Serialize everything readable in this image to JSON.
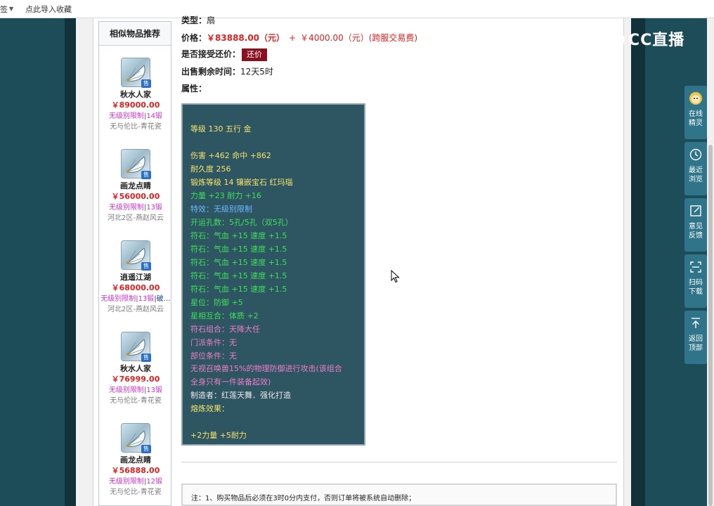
{
  "bookmarks_bar": {
    "dropdown_label": "签",
    "import_link": "点此导入收藏"
  },
  "sidebar": {
    "title": "相似物品推荐",
    "sale_badge": "售",
    "items": [
      {
        "name": "秋水人家",
        "price": "￥89000.00",
        "tag1": "无级别限制",
        "sep": "|",
        "tag2": "14锻",
        "tag3": "",
        "server": "无与伦比-青花瓷",
        "icon": "fan-icon"
      },
      {
        "name": "画龙点睛",
        "price": "￥56000.00",
        "tag1": "无级别限制",
        "sep": "|",
        "tag2": "13锻",
        "tag3": "",
        "server": "河北2区-燕赵风云",
        "icon": "fan-icon"
      },
      {
        "name": "逍遥江湖",
        "price": "￥68000.00",
        "tag1": "无级别限制",
        "sep": "|",
        "tag2": "13锻",
        "tag3": "|破…",
        "server": "河北2区-燕赵风云",
        "icon": "fan-icon"
      },
      {
        "name": "秋水人家",
        "price": "￥76999.00",
        "tag1": "无级别限制",
        "sep": "|",
        "tag2": "13锻",
        "tag3": "",
        "server": "无与伦比-青花瓷",
        "icon": "fan-icon"
      },
      {
        "name": "画龙点睛",
        "price": "￥56888.00",
        "tag1": "无级别限制",
        "sep": "|",
        "tag2": "12锻",
        "tag3": "",
        "server": "无与伦比-青花瓷",
        "icon": "fan-icon"
      }
    ]
  },
  "detail": {
    "type_label": "类型：",
    "type_value": "扇",
    "price_label": "价格：",
    "price_value": "￥83888.00（元）",
    "price_plus": "+",
    "fee_value": "￥4000.00（元）(跨服交易费)",
    "bargain_label": "是否接受还价：",
    "bargain_button": "还价",
    "time_label": "出售剩余时间：",
    "time_value": "12天5时",
    "attr_label": "属性："
  },
  "attributes": [
    {
      "text": "等级 130 五行 金",
      "color": "yellow"
    },
    {
      "text": "伤害 +462 命中 +862",
      "color": "yellow"
    },
    {
      "text": "耐久度 256",
      "color": "yellow"
    },
    {
      "text": "锻炼等级 14 镶嵌宝石 红玛瑙",
      "color": "yellow"
    },
    {
      "text": "力量 +23 耐力 +16",
      "color": "green"
    },
    {
      "text": "特效：无级别限制",
      "color": "blue"
    },
    {
      "text": "开运孔数：5孔/5孔（双5孔）",
      "color": "green"
    },
    {
      "text": "符石：气血 +15 速度 +1.5",
      "color": "green"
    },
    {
      "text": "符石：气血 +15 速度 +1.5",
      "color": "green"
    },
    {
      "text": "符石：气血 +15 速度 +1.5",
      "color": "green"
    },
    {
      "text": "符石：气血 +15 速度 +1.5",
      "color": "green"
    },
    {
      "text": "符石：气血 +15 速度 +1.5",
      "color": "green"
    },
    {
      "text": "星位：防御 +5",
      "color": "green"
    },
    {
      "text": "星相互合：体质 +2",
      "color": "green"
    },
    {
      "text": "符石组合：天降大任",
      "color": "pink"
    },
    {
      "text": "门派条件：无",
      "color": "pink"
    },
    {
      "text": "部位条件：无",
      "color": "pink"
    },
    {
      "text": "无视召唤兽15%的物理防御进行攻击(该组合",
      "color": "pink"
    },
    {
      "text": "全身只有一件装备起效)",
      "color": "pink"
    },
    {
      "text": "制造者：红莲天舞．强化打造",
      "color": "white"
    },
    {
      "text": "熔炼效果：",
      "color": "yellow"
    },
    {
      "text": "+2力量 +5耐力",
      "color": "yellow"
    }
  ],
  "notice": {
    "text": "注：1、购买物品后必须在3时0分内支付，否则订单将被系统自动删除；"
  },
  "watermark": {
    "text": "CC直播"
  },
  "float_toolbar": [
    {
      "label": "在线精灵",
      "icon": "avatar-icon"
    },
    {
      "label": "最近浏览",
      "icon": "clock-icon"
    },
    {
      "label": "意见反馈",
      "icon": "edit-icon"
    },
    {
      "label": "扫码下载",
      "icon": "scan-icon"
    },
    {
      "label": "返回顶部",
      "icon": "arrow-up-icon"
    }
  ],
  "colors": {
    "accent_red": "#e02020",
    "bargain_bg": "#8a1020",
    "attr_bg": "#2e5562",
    "toolbar_bg": "#2f7488",
    "yellow": "#f5e36a",
    "green": "#3fe05a",
    "blue": "#6ab8ff",
    "pink": "#ee7ec8",
    "white": "#e8e8e8"
  }
}
